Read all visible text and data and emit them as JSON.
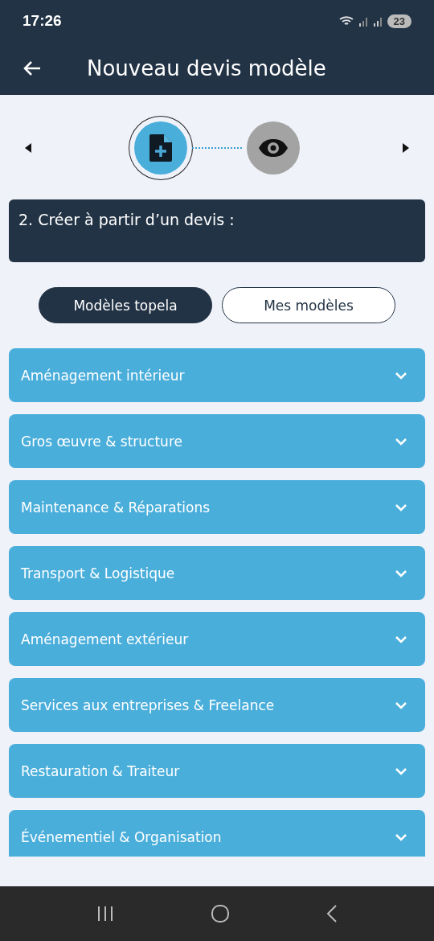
{
  "status_bar": {
    "time": "17:26",
    "battery": "23"
  },
  "app_bar": {
    "title": "Nouveau devis modèle"
  },
  "steps": [
    {
      "kind": "document",
      "selected": true
    },
    {
      "kind": "preview",
      "selected": false
    }
  ],
  "section_title": "2. Créer à partir d’un devis :",
  "tabs": [
    {
      "label": "Modèles topela",
      "selected": true
    },
    {
      "label": "Mes modèles",
      "selected": false
    }
  ],
  "categories": [
    {
      "label": "Aménagement intérieur",
      "expanded": false
    },
    {
      "label": "Gros œuvre & structure",
      "expanded": false
    },
    {
      "label": "Maintenance & Réparations",
      "expanded": false
    },
    {
      "label": "Transport & Logistique",
      "expanded": false
    },
    {
      "label": "Aménagement extérieur",
      "expanded": false
    },
    {
      "label": "Services aux entreprises & Freelance",
      "expanded": false
    },
    {
      "label": "Restauration & Traiteur",
      "expanded": false
    },
    {
      "label": "Événementiel & Organisation",
      "expanded": false
    }
  ]
}
